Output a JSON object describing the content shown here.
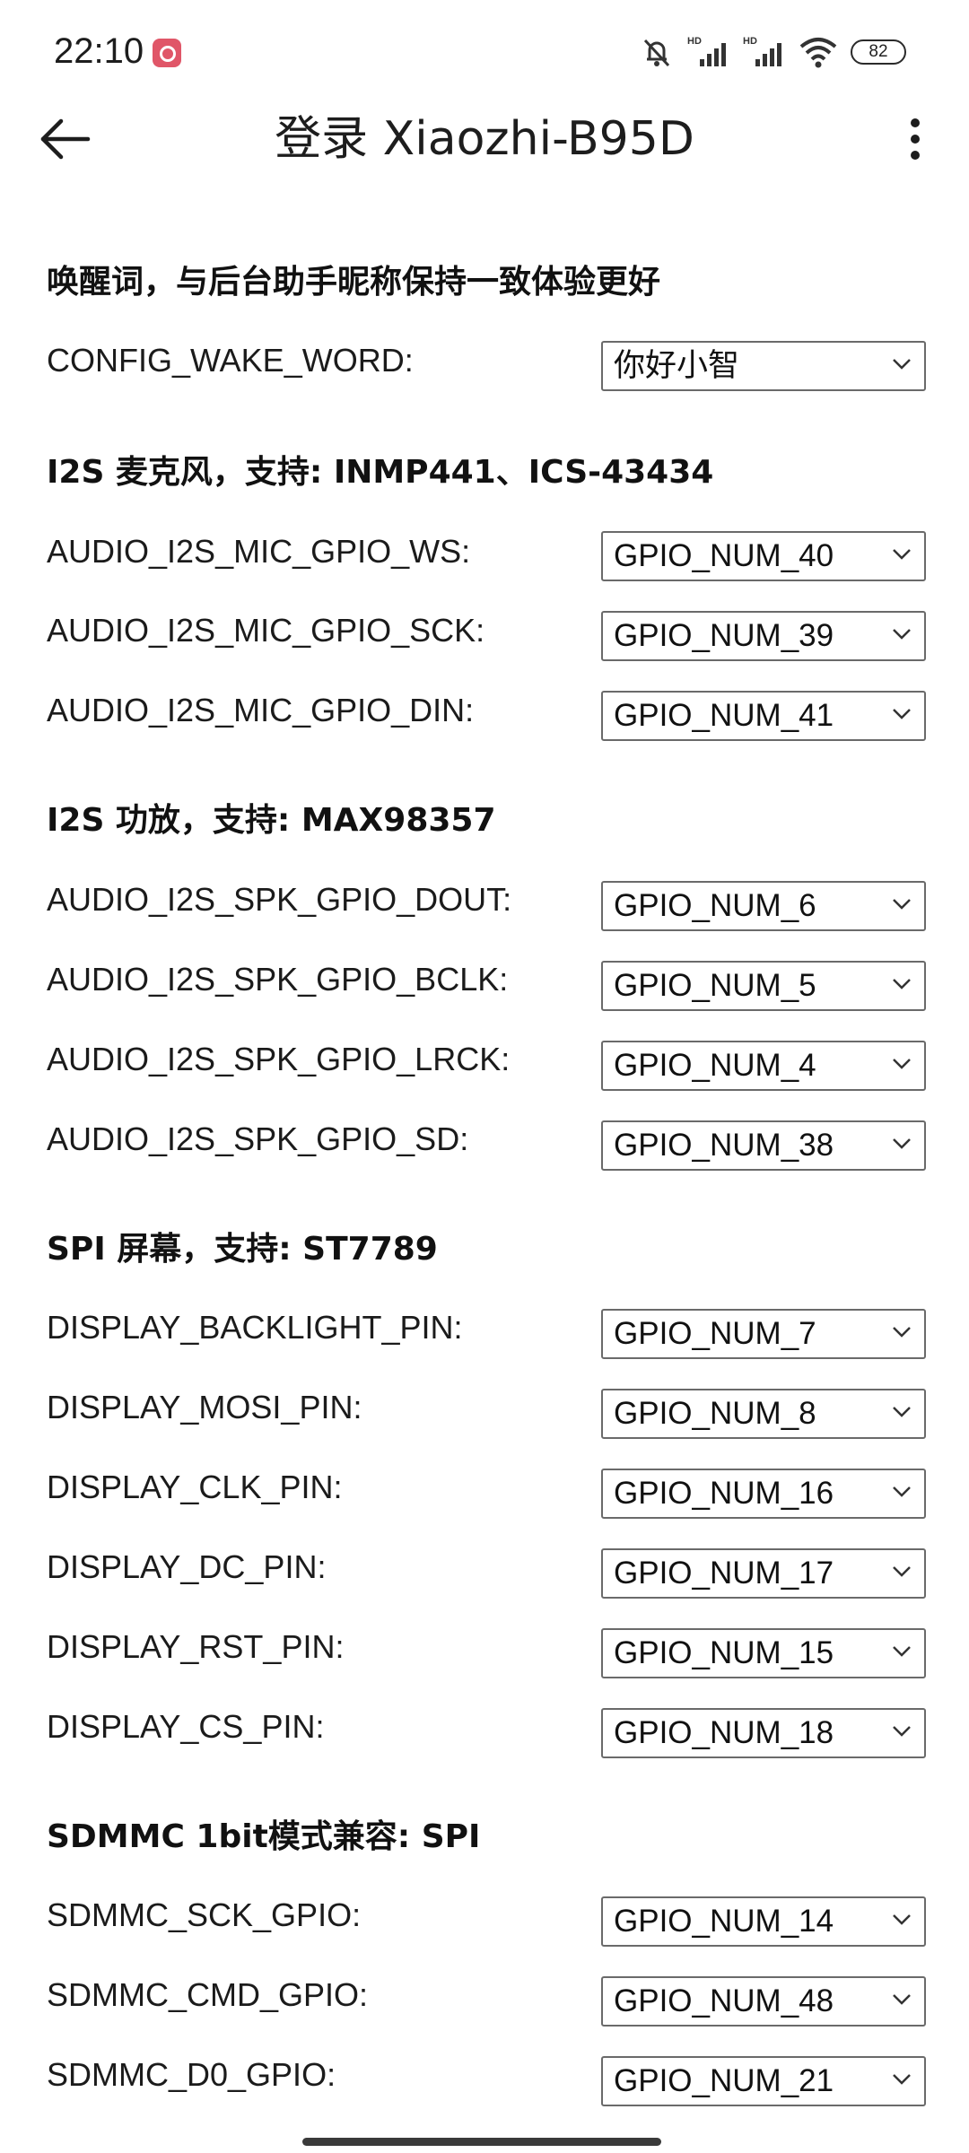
{
  "status_bar": {
    "time": "22:10",
    "battery": "82",
    "icons": [
      "app-notification-icon",
      "mute-icon",
      "signal-hd-icon",
      "signal-hd-icon",
      "wifi-icon",
      "battery-icon"
    ]
  },
  "app_bar": {
    "title": "登录 Xiaozhi-B95D",
    "back_icon": "arrow-left-icon",
    "more_icon": "more-vertical-icon"
  },
  "sections": [
    {
      "heading": "唤醒词，与后台助手昵称保持一致体验更好",
      "fields": [
        {
          "label": "CONFIG_WAKE_WORD:",
          "value": "你好小智"
        }
      ]
    },
    {
      "heading": "I2S 麦克风，支持: INMP441、ICS-43434",
      "fields": [
        {
          "label": "AUDIO_I2S_MIC_GPIO_WS:",
          "value": "GPIO_NUM_40"
        },
        {
          "label": "AUDIO_I2S_MIC_GPIO_SCK:",
          "value": "GPIO_NUM_39"
        },
        {
          "label": "AUDIO_I2S_MIC_GPIO_DIN:",
          "value": "GPIO_NUM_41"
        }
      ]
    },
    {
      "heading": "I2S 功放，支持: MAX98357",
      "fields": [
        {
          "label": "AUDIO_I2S_SPK_GPIO_DOUT:",
          "value": "GPIO_NUM_6"
        },
        {
          "label": "AUDIO_I2S_SPK_GPIO_BCLK:",
          "value": "GPIO_NUM_5"
        },
        {
          "label": "AUDIO_I2S_SPK_GPIO_LRCK:",
          "value": "GPIO_NUM_4"
        },
        {
          "label": "AUDIO_I2S_SPK_GPIO_SD:",
          "value": "GPIO_NUM_38"
        }
      ]
    },
    {
      "heading": "SPI 屏幕，支持: ST7789",
      "fields": [
        {
          "label": "DISPLAY_BACKLIGHT_PIN:",
          "value": "GPIO_NUM_7"
        },
        {
          "label": "DISPLAY_MOSI_PIN:",
          "value": "GPIO_NUM_8"
        },
        {
          "label": "DISPLAY_CLK_PIN:",
          "value": "GPIO_NUM_16"
        },
        {
          "label": "DISPLAY_DC_PIN:",
          "value": "GPIO_NUM_17"
        },
        {
          "label": "DISPLAY_RST_PIN:",
          "value": "GPIO_NUM_15"
        },
        {
          "label": "DISPLAY_CS_PIN:",
          "value": "GPIO_NUM_18"
        }
      ]
    },
    {
      "heading": "SDMMC 1bit模式兼容: SPI",
      "fields": [
        {
          "label": "SDMMC_SCK_GPIO:",
          "value": "GPIO_NUM_14"
        },
        {
          "label": "SDMMC_CMD_GPIO:",
          "value": "GPIO_NUM_48"
        },
        {
          "label": "SDMMC_D0_GPIO:",
          "value": "GPIO_NUM_21"
        }
      ]
    }
  ]
}
